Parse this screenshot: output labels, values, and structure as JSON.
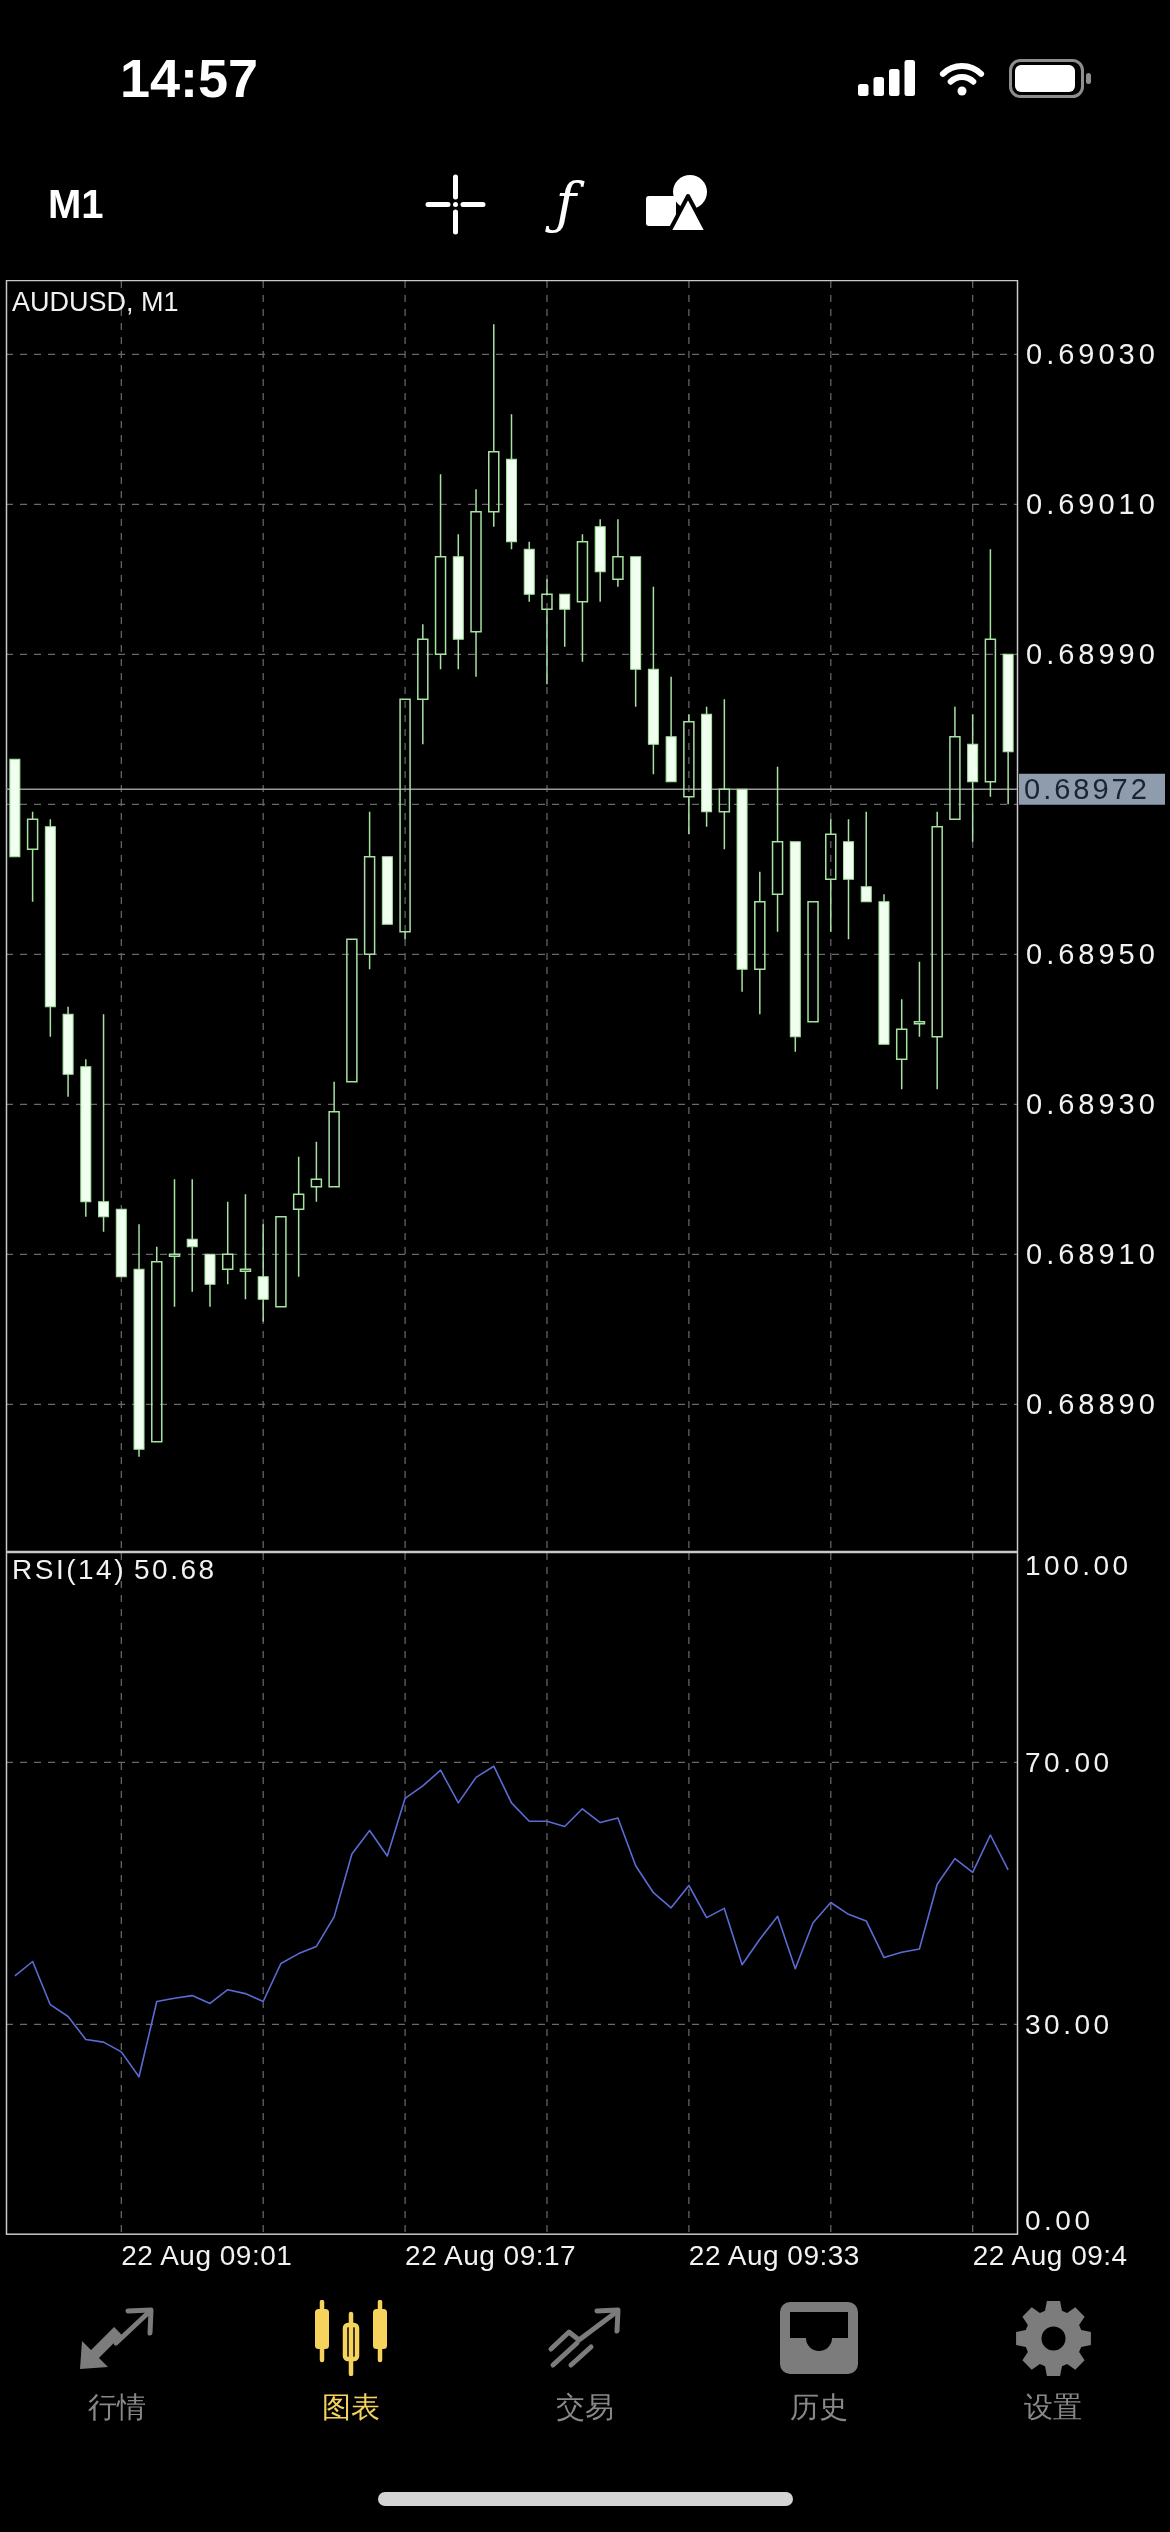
{
  "status_bar": {
    "time": "14:57"
  },
  "toolbar": {
    "timeframe": "M1",
    "indicator_button": "ƒ"
  },
  "price_chart": {
    "chart_data": {
      "type": "candlestick",
      "title": "AUDUSD, M1",
      "categories": [
        null,
        null,
        null,
        null,
        null,
        null,
        null,
        null,
        null,
        null,
        null,
        null,
        null,
        null,
        null,
        null,
        null,
        null,
        null,
        null,
        null,
        null,
        null,
        null,
        null,
        null,
        null,
        null,
        null,
        null,
        null,
        null,
        null,
        null,
        null,
        null,
        null,
        null,
        null,
        null,
        null,
        null,
        null,
        null,
        null,
        null,
        null,
        null,
        null,
        null,
        null,
        null,
        null,
        null,
        null,
        null,
        null
      ],
      "ylim": [
        0.688703,
        0.690399
      ],
      "yticks": [
        {
          "value": 0.6903,
          "label": "0.69030"
        },
        {
          "value": 0.6901,
          "label": "0.69010"
        },
        {
          "value": 0.6899,
          "label": "0.68990"
        },
        {
          "value": 0.6895,
          "label": "0.68950"
        },
        {
          "value": 0.6893,
          "label": "0.68930"
        },
        {
          "value": 0.6891,
          "label": "0.68910"
        },
        {
          "value": 0.6889,
          "label": "0.68890"
        }
      ],
      "grid": true,
      "ohlc": [
        [
          0.68976,
          0.68976,
          0.68963,
          0.68963
        ],
        [
          0.68964,
          0.68969,
          0.68957,
          0.68968
        ],
        [
          0.68967,
          0.68968,
          0.68939,
          0.68943
        ],
        [
          0.68942,
          0.68943,
          0.68931,
          0.68934
        ],
        [
          0.68935,
          0.68936,
          0.68915,
          0.68917
        ],
        [
          0.68917,
          0.68942,
          0.68913,
          0.68915
        ],
        [
          0.68916,
          0.68916,
          0.68907,
          0.68907
        ],
        [
          0.68908,
          0.68914,
          0.68883,
          0.68884
        ],
        [
          0.68885,
          0.68911,
          0.68885,
          0.68909
        ],
        [
          0.6891,
          0.6892,
          0.68903,
          0.6891
        ],
        [
          0.68912,
          0.6892,
          0.68905,
          0.68911
        ],
        [
          0.6891,
          0.6891,
          0.68903,
          0.68906
        ],
        [
          0.68908,
          0.68917,
          0.68906,
          0.6891
        ],
        [
          0.68908,
          0.68918,
          0.68904,
          0.68908
        ],
        [
          0.68907,
          0.68914,
          0.68901,
          0.68904
        ],
        [
          0.68903,
          0.68915,
          0.68903,
          0.68915
        ],
        [
          0.68916,
          0.68923,
          0.68907,
          0.68918
        ],
        [
          0.68919,
          0.68925,
          0.68917,
          0.6892
        ],
        [
          0.68919,
          0.68933,
          0.68919,
          0.68929
        ],
        [
          0.68933,
          0.68952,
          0.68933,
          0.68952
        ],
        [
          0.6895,
          0.68969,
          0.68948,
          0.68963
        ],
        [
          0.68963,
          0.68963,
          0.68954,
          0.68954
        ],
        [
          0.68953,
          0.68984,
          0.68952,
          0.68984
        ],
        [
          0.68984,
          0.68994,
          0.68978,
          0.68992
        ],
        [
          0.6899,
          0.69014,
          0.68988,
          0.69003
        ],
        [
          0.69003,
          0.69006,
          0.68988,
          0.68992
        ],
        [
          0.68993,
          0.69012,
          0.68987,
          0.69009
        ],
        [
          0.69009,
          0.69034,
          0.69007,
          0.69017
        ],
        [
          0.69016,
          0.69022,
          0.69004,
          0.69005
        ],
        [
          0.69004,
          0.69005,
          0.68997,
          0.68998
        ],
        [
          0.68996,
          0.69,
          0.68986,
          0.68998
        ],
        [
          0.68998,
          0.68998,
          0.68991,
          0.68996
        ],
        [
          0.68997,
          0.69006,
          0.68989,
          0.69005
        ],
        [
          0.69007,
          0.69008,
          0.68997,
          0.69001
        ],
        [
          0.69,
          0.69008,
          0.68999,
          0.69003
        ],
        [
          0.69003,
          0.69003,
          0.68983,
          0.68988
        ],
        [
          0.68988,
          0.68999,
          0.68974,
          0.68978
        ],
        [
          0.68979,
          0.68987,
          0.68973,
          0.68973
        ],
        [
          0.68971,
          0.68982,
          0.68966,
          0.68981
        ],
        [
          0.68982,
          0.68983,
          0.68967,
          0.68969
        ],
        [
          0.68969,
          0.68984,
          0.68964,
          0.68972
        ],
        [
          0.68972,
          0.68972,
          0.68945,
          0.68948
        ],
        [
          0.68948,
          0.68961,
          0.68942,
          0.68957
        ],
        [
          0.68958,
          0.68975,
          0.68953,
          0.68965
        ],
        [
          0.68965,
          0.68965,
          0.68937,
          0.68939
        ],
        [
          0.68941,
          0.68957,
          0.68941,
          0.68957
        ],
        [
          0.6896,
          0.68968,
          0.68953,
          0.68966
        ],
        [
          0.68965,
          0.68968,
          0.68952,
          0.6896
        ],
        [
          0.68959,
          0.68969,
          0.68957,
          0.68957
        ],
        [
          0.68957,
          0.68958,
          0.68938,
          0.68938
        ],
        [
          0.68936,
          0.68944,
          0.68932,
          0.6894
        ],
        [
          0.68941,
          0.68949,
          0.68939,
          0.68941
        ],
        [
          0.68939,
          0.68969,
          0.68932,
          0.68967
        ],
        [
          0.68968,
          0.68983,
          0.68968,
          0.68979
        ],
        [
          0.68978,
          0.68982,
          0.68965,
          0.68973
        ],
        [
          0.68973,
          0.69004,
          0.68971,
          0.68992
        ],
        [
          0.6899,
          0.6899,
          0.6897,
          0.68977
        ]
      ],
      "ref_lines": [
        {
          "axis": "y",
          "value": 0.68972,
          "label": "0.68972"
        }
      ]
    }
  },
  "rsi_panel": {
    "reading": "50.68",
    "chart_data": {
      "type": "line",
      "categories": [
        null,
        null,
        null,
        null,
        null,
        null,
        null,
        null,
        null,
        null,
        null,
        null,
        null,
        null,
        null,
        null,
        null,
        null,
        null,
        null,
        null,
        null,
        null,
        null,
        null,
        null,
        null,
        null,
        null,
        null,
        null,
        null,
        null,
        null,
        null,
        null,
        null,
        null,
        null,
        null,
        null,
        null,
        null,
        null,
        null,
        null,
        null,
        null,
        null,
        null,
        null,
        null,
        null,
        null,
        null,
        null,
        null
      ],
      "ylim": [
        -2.1,
        102.1
      ],
      "yticks": [
        {
          "value": 100,
          "label": "100.00"
        },
        {
          "value": 70,
          "label": "70.00"
        },
        {
          "value": 30,
          "label": "30.00"
        },
        {
          "value": 0,
          "label": "0.00"
        }
      ],
      "grid": true,
      "series": [
        {
          "name": "RSI(14)",
          "color": "#5b6bd4",
          "values": [
            37.4,
            39.6,
            33.0,
            31.2,
            27.7,
            27.3,
            25.8,
            22.0,
            33.5,
            34.0,
            34.4,
            33.2,
            35.3,
            34.7,
            33.5,
            39.3,
            40.8,
            41.9,
            46.4,
            56.0,
            59.6,
            55.7,
            64.5,
            66.4,
            68.8,
            63.8,
            67.7,
            69.4,
            63.8,
            61.0,
            61.0,
            60.2,
            62.9,
            60.8,
            61.5,
            54.2,
            50.1,
            47.8,
            51.2,
            46.3,
            47.7,
            39.1,
            43.0,
            46.5,
            38.5,
            45.5,
            48.6,
            46.8,
            45.8,
            40.2,
            41.0,
            41.5,
            51.4,
            55.3,
            53.2,
            58.9,
            53.6
          ]
        }
      ]
    }
  },
  "time_axis": {
    "labels": [
      "22 Aug 09:01",
      "22 Aug 09:17",
      "22 Aug 09:33",
      "22 Aug 09:4"
    ]
  },
  "tabs": [
    {
      "label": "行情",
      "selected": false
    },
    {
      "label": "图表",
      "selected": true
    },
    {
      "label": "交易",
      "selected": false
    },
    {
      "label": "历史",
      "selected": false
    },
    {
      "label": "设置",
      "selected": false
    }
  ]
}
